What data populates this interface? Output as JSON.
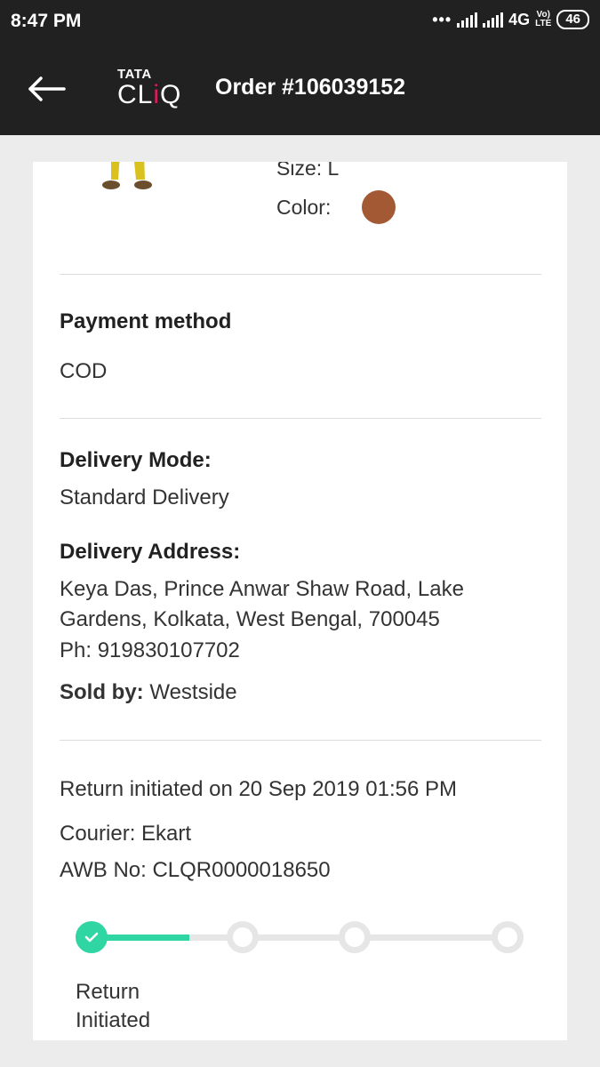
{
  "status_bar": {
    "time": "8:47 PM",
    "dots": "•••",
    "network": "4G",
    "volte_top": "Vo)",
    "volte_bottom": "LTE",
    "battery": "46"
  },
  "header": {
    "back_icon": "arrow-left-icon",
    "logo_top": "TATA",
    "logo_bottom_pre": "CL",
    "logo_bottom_i": "i",
    "logo_bottom_post": "Q",
    "title": "Order #106039152"
  },
  "product": {
    "size_label": "Size: L",
    "color_label": "Color:",
    "color_swatch": "#a35a34"
  },
  "payment": {
    "heading": "Payment method",
    "value": "COD"
  },
  "delivery": {
    "mode_heading": "Delivery Mode:",
    "mode_value": "Standard Delivery",
    "address_heading": "Delivery Address:",
    "address": "Keya Das, Prince Anwar Shaw Road, Lake Gardens, Kolkata, West Bengal, 700045",
    "phone": "Ph: 919830107702",
    "sold_by_label": "Sold by:",
    "sold_by_value": "Westside"
  },
  "return": {
    "initiated_text": "Return initiated on 20 Sep 2019  01:56 PM",
    "courier": "Courier: Ekart",
    "awb": "AWB No: CLQR0000018650",
    "current_step_label": "Return Initiated",
    "progress_fraction": 0.25
  },
  "colors": {
    "accent": "#2fd6a4",
    "header_bg": "#212121",
    "logo_accent": "#da1c5c"
  }
}
